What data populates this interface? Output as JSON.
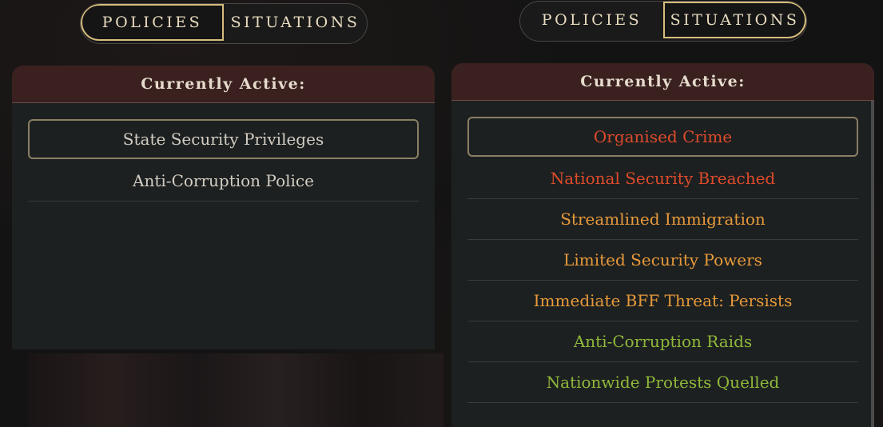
{
  "left": {
    "tabs": [
      {
        "label": "POLICIES",
        "active": true
      },
      {
        "label": "SITUATIONS",
        "active": false
      }
    ],
    "header": "Currently Active:",
    "items": [
      {
        "label": "State Security Privileges",
        "color": "#d2cdc3",
        "selected": true
      },
      {
        "label": "Anti-Corruption Police",
        "color": "#d2cdc3",
        "selected": false
      }
    ]
  },
  "right": {
    "tabs": [
      {
        "label": "POLICIES",
        "active": false
      },
      {
        "label": "SITUATIONS",
        "active": true
      }
    ],
    "header": "Currently Active:",
    "items": [
      {
        "label": "Organised Crime",
        "color": "#de4b2c",
        "selected": true
      },
      {
        "label": "National Security Breached",
        "color": "#de4b2c",
        "selected": false
      },
      {
        "label": "Streamlined Immigration",
        "color": "#e79a3b",
        "selected": false
      },
      {
        "label": "Limited Security Powers",
        "color": "#e79a3b",
        "selected": false
      },
      {
        "label": "Immediate BFF Threat: Persists",
        "color": "#e79a3b",
        "selected": false
      },
      {
        "label": "Anti-Corruption Raids",
        "color": "#8fb83a",
        "selected": false
      },
      {
        "label": "Nationwide Protests Quelled",
        "color": "#8fb83a",
        "selected": false
      }
    ]
  },
  "colors": {
    "accent_border": "#d7bd7d",
    "header_bg": "#3a2120",
    "panel_bg": "#1d2020"
  }
}
